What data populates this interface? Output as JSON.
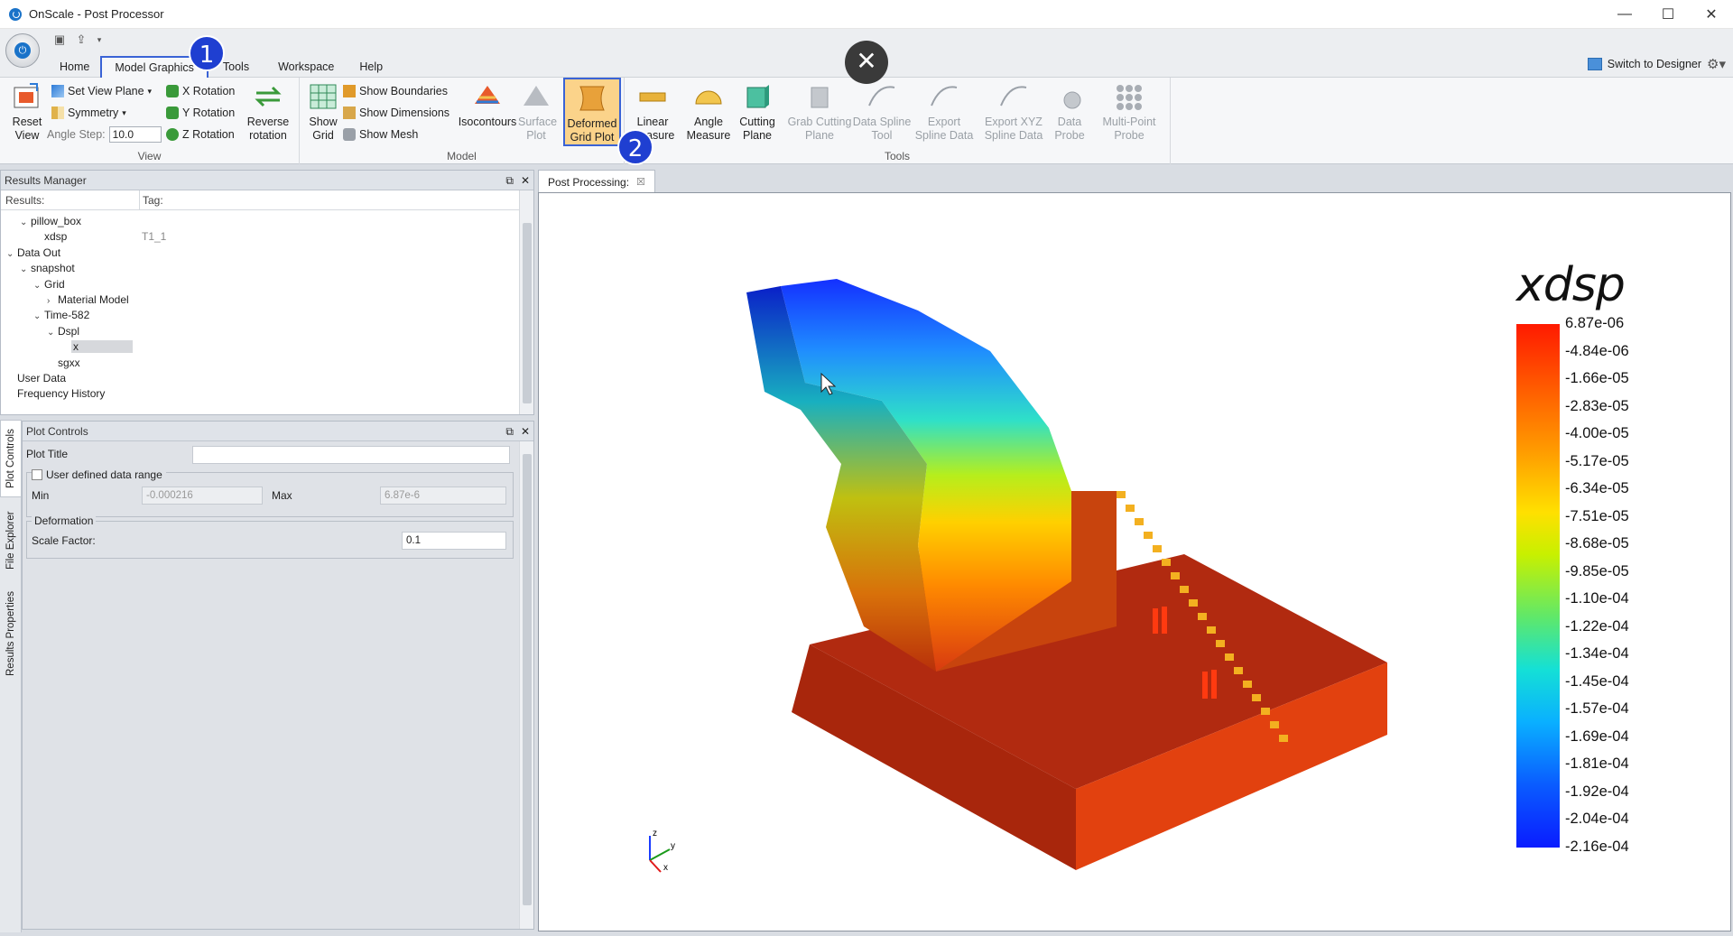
{
  "window": {
    "title": "OnScale - Post Processor",
    "minimize": "—",
    "maximize": "☐",
    "close": "✕"
  },
  "ribbon_tabs": [
    "Home",
    "Model Graphics",
    "Tools",
    "Workspace",
    "Help"
  ],
  "active_tab": "Model Graphics",
  "switch_designer": "Switch to Designer",
  "badges": {
    "one": "1",
    "two": "2"
  },
  "overlay_close": "✕",
  "view_group": {
    "label": "View",
    "reset_view": "Reset View",
    "set_view_plane": "Set View Plane",
    "symmetry": "Symmetry",
    "angle_step_label": "Angle Step:",
    "angle_step_value": "10.0",
    "x_rotation": "X Rotation",
    "y_rotation": "Y Rotation",
    "z_rotation": "Z Rotation",
    "reverse_rotation": "Reverse rotation"
  },
  "model_group": {
    "label": "Model",
    "show_grid": "Show Grid",
    "show_boundaries": "Show Boundaries",
    "show_dimensions": "Show Dimensions",
    "show_mesh": "Show Mesh",
    "isocontours": "Isocontours",
    "surface_plot": "Surface Plot",
    "deformed_grid_plot": "Deformed Grid Plot"
  },
  "tools_group": {
    "label": "Tools",
    "linear_measure": "Linear Measure",
    "angle_measure": "Angle Measure",
    "cutting_plane": "Cutting Plane",
    "grab_cutting_plane": "Grab Cutting Plane",
    "data_spline_tool": "Data Spline Tool",
    "export_spline_data": "Export Spline Data",
    "export_xyz_spline_data": "Export XYZ Spline Data",
    "data_probe": "Data Probe",
    "multi_point_probe": "Multi-Point Probe"
  },
  "results_manager": {
    "title": "Results Manager",
    "col_results": "Results:",
    "col_tag": "Tag:",
    "tree": [
      {
        "label": "pillow_box",
        "depth": 1,
        "chevron": "down"
      },
      {
        "label": "xdsp",
        "depth": 2,
        "tag": "T1_1"
      },
      {
        "label": "Data Out",
        "depth": 0,
        "chevron": "down"
      },
      {
        "label": "snapshot",
        "depth": 1,
        "chevron": "down"
      },
      {
        "label": "Grid",
        "depth": 2,
        "chevron": "down"
      },
      {
        "label": "Material Model",
        "depth": 3,
        "chevron": "right"
      },
      {
        "label": "Time-582",
        "depth": 2,
        "chevron": "down"
      },
      {
        "label": "Dspl",
        "depth": 3,
        "chevron": "down"
      },
      {
        "label": "x",
        "depth": 4,
        "selected": true
      },
      {
        "label": "sgxx",
        "depth": 3
      },
      {
        "label": "User Data",
        "depth": 0
      },
      {
        "label": "Frequency History",
        "depth": 0
      }
    ]
  },
  "plot_controls": {
    "title": "Plot Controls",
    "side_tabs": [
      "Plot Controls",
      "File Explorer",
      "Results Properties"
    ],
    "plot_title_label": "Plot Title",
    "plot_title_value": "",
    "user_defined_range": "User defined data range",
    "min_label": "Min",
    "min_value": "-0.000216",
    "max_label": "Max",
    "max_value": "6.87e-6",
    "deformation_label": "Deformation",
    "scale_factor_label": "Scale Factor:",
    "scale_factor_value": "0.1"
  },
  "viewport": {
    "tab_label": "Post Processing:",
    "legend_title": "xdsp",
    "legend_labels": [
      "6.87e-06",
      "-4.84e-06",
      "-1.66e-05",
      "-2.83e-05",
      "-4.00e-05",
      "-5.17e-05",
      "-6.34e-05",
      "-7.51e-05",
      "-8.68e-05",
      "-9.85e-05",
      "-1.10e-04",
      "-1.22e-04",
      "-1.34e-04",
      "-1.45e-04",
      "-1.57e-04",
      "-1.69e-04",
      "-1.81e-04",
      "-1.92e-04",
      "-2.04e-04",
      "-2.16e-04"
    ],
    "axes": {
      "z": "z",
      "y": "y",
      "x": "x"
    }
  },
  "colors": {
    "accent": "#3a63d6",
    "highlight": "#fbd38a",
    "badge": "#1f3fd1"
  }
}
